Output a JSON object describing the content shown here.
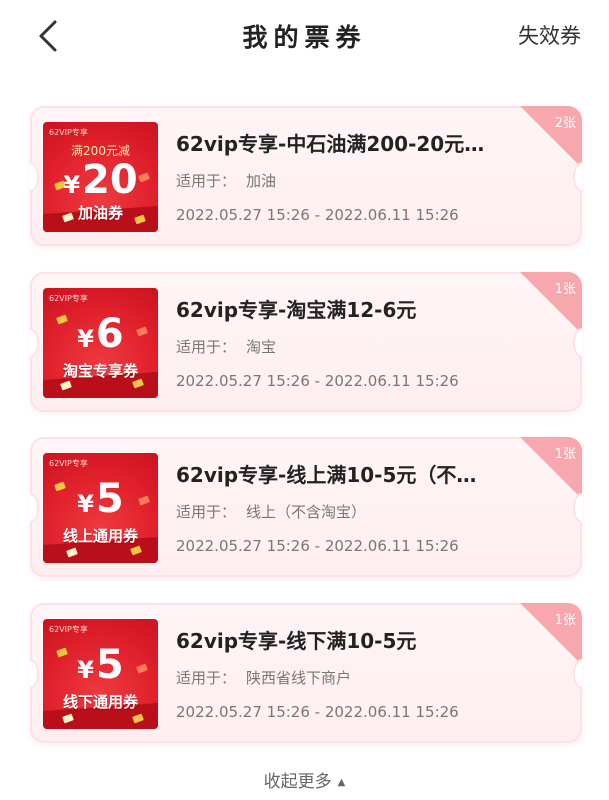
{
  "header": {
    "title": "我的票券",
    "right_action": "失效券"
  },
  "tickets": [
    {
      "thumb_tag": "62VIP专享",
      "thumb_condition": "满200元减",
      "currency": "¥",
      "thumb_amount": "20",
      "thumb_type": "加油券",
      "name": "62vip专享-中石油满200-20元…",
      "scope_label": "适用于：",
      "scope": "加油",
      "date": "2022.05.27 15:26 - 2022.06.11 15:26",
      "count": "2张"
    },
    {
      "thumb_tag": "62VIP专享",
      "thumb_condition": "",
      "currency": "¥",
      "thumb_amount": "6",
      "thumb_type": "淘宝专享券",
      "name": "62vip专享-淘宝满12-6元",
      "scope_label": "适用于：",
      "scope": "淘宝",
      "date": "2022.05.27 15:26 - 2022.06.11 15:26",
      "count": "1张"
    },
    {
      "thumb_tag": "62VIP专享",
      "thumb_condition": "",
      "currency": "¥",
      "thumb_amount": "5",
      "thumb_type": "线上通用券",
      "name": "62vip专享-线上满10-5元（不…",
      "scope_label": "适用于：",
      "scope": "线上（不含淘宝）",
      "date": "2022.05.27 15:26 - 2022.06.11 15:26",
      "count": "1张"
    },
    {
      "thumb_tag": "62VIP专享",
      "thumb_condition": "",
      "currency": "¥",
      "thumb_amount": "5",
      "thumb_type": "线下通用券",
      "name": "62vip专享-线下满10-5元",
      "scope_label": "适用于：",
      "scope": "陕西省线下商户",
      "date": "2022.05.27 15:26 - 2022.06.11 15:26",
      "count": "1张"
    }
  ],
  "footer": {
    "collapse_label": "收起更多",
    "collapse_icon": "triangle-up-icon"
  },
  "colors": {
    "accent_red": "#df1f2a",
    "count_badge": "#f9a7ae",
    "card_bg": "#fff5f6"
  }
}
